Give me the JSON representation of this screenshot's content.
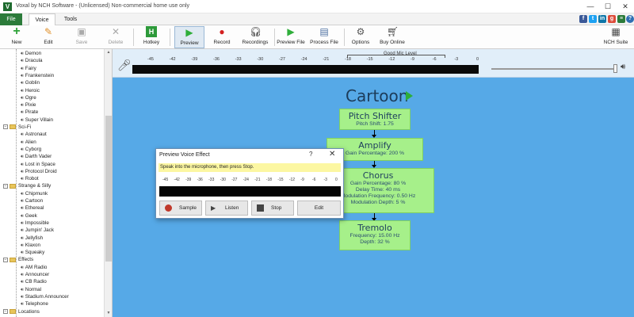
{
  "window": {
    "title": "Voxal by NCH Software - (Unlicensed) Non-commercial home use only",
    "app_icon": "V",
    "controls": {
      "minimize": "—",
      "maximize": "☐",
      "close": "✕"
    }
  },
  "menu": {
    "file": "File",
    "tabs": [
      "Voice",
      "Tools"
    ],
    "active_tab": "Voice"
  },
  "social_icons": [
    "facebook-icon",
    "twitter-icon",
    "linkedin-icon",
    "google-plus-icon",
    "nch-icon",
    "help-icon"
  ],
  "toolbar": {
    "new": "New",
    "edit": "Edit",
    "save": "Save",
    "delete": "Delete",
    "hotkey": "Hotkey",
    "preview": "Preview",
    "record": "Record",
    "recordings": "Recordings",
    "preview_file": "Preview File",
    "process_file": "Process File",
    "options": "Options",
    "buy_online": "Buy Online",
    "nch_suite": "NCH Suite"
  },
  "sidebar": {
    "rows": [
      {
        "type": "voice",
        "label": "Demon"
      },
      {
        "type": "voice",
        "label": "Dracula"
      },
      {
        "type": "voice",
        "label": "Fairy"
      },
      {
        "type": "voice",
        "label": "Frankenstein"
      },
      {
        "type": "voice",
        "label": "Goblin"
      },
      {
        "type": "voice",
        "label": "Heroic"
      },
      {
        "type": "voice",
        "label": "Ogre"
      },
      {
        "type": "voice",
        "label": "Pixie"
      },
      {
        "type": "voice",
        "label": "Pirate"
      },
      {
        "type": "voice",
        "label": "Super Villain"
      },
      {
        "type": "folder",
        "label": "Sci-Fi"
      },
      {
        "type": "voice",
        "label": "Astronaut"
      },
      {
        "type": "voice",
        "label": "Alien"
      },
      {
        "type": "voice",
        "label": "Cyborg"
      },
      {
        "type": "voice",
        "label": "Darth Vader"
      },
      {
        "type": "voice",
        "label": "Lost in Space"
      },
      {
        "type": "voice",
        "label": "Protocol Droid"
      },
      {
        "type": "voice",
        "label": "Robot"
      },
      {
        "type": "folder",
        "label": "Strange & Silly"
      },
      {
        "type": "voice",
        "label": "Chipmunk"
      },
      {
        "type": "voice",
        "label": "Cartoon"
      },
      {
        "type": "voice",
        "label": "Ethereal"
      },
      {
        "type": "voice",
        "label": "Geek"
      },
      {
        "type": "voice",
        "label": "Impossible"
      },
      {
        "type": "voice",
        "label": "Jumpin' Jack"
      },
      {
        "type": "voice",
        "label": "Jellyfish"
      },
      {
        "type": "voice",
        "label": "Klaxon"
      },
      {
        "type": "voice",
        "label": "Squeaky"
      },
      {
        "type": "folder",
        "label": "Effects"
      },
      {
        "type": "voice",
        "label": "AM Radio"
      },
      {
        "type": "voice",
        "label": "Announcer"
      },
      {
        "type": "voice",
        "label": "CB Radio"
      },
      {
        "type": "voice",
        "label": "Normal"
      },
      {
        "type": "voice",
        "label": "Stadium Announcer"
      },
      {
        "type": "voice",
        "label": "Telephone"
      },
      {
        "type": "folder",
        "label": "Locations"
      }
    ]
  },
  "level_meter": {
    "good_level_label": "Good Mic Level",
    "scale": [
      "-45",
      "-42",
      "-39",
      "-36",
      "-33",
      "-30",
      "-27",
      "-24",
      "-21",
      "-18",
      "-15",
      "-12",
      "-9",
      "-6",
      "-3",
      "0"
    ]
  },
  "voice": {
    "name": "Cartoon",
    "effects": [
      {
        "name": "Pitch Shifter",
        "params": [
          "Pitch Shift: 1.75"
        ]
      },
      {
        "name": "Amplify",
        "params": [
          "Gain Percentage: 200 %"
        ]
      },
      {
        "name": "Chorus",
        "params": [
          "Gain Percentage: 80 %",
          "Delay Time: 40 ms",
          "Modulation Frequency: 0.50 Hz",
          "Modulation Depth: 5 %"
        ]
      },
      {
        "name": "Tremolo",
        "params": [
          "Frequency: 15.00 Hz",
          "Depth: 32 %"
        ]
      }
    ]
  },
  "dialog": {
    "title": "Preview Voice Effect",
    "help": "?",
    "close": "✕",
    "message": "Speak into the microphone, then press Stop.",
    "scale": [
      "-45",
      "-42",
      "-39",
      "-36",
      "-33",
      "-30",
      "-27",
      "-24",
      "-21",
      "-18",
      "-15",
      "-12",
      "-9",
      "-6",
      "-3",
      "0"
    ],
    "buttons": {
      "sample": "Sample",
      "listen": "Listen",
      "stop": "Stop",
      "edit": "Edit"
    }
  },
  "colors": {
    "main_bg": "#56a9e7",
    "effect_box": "#a6f08a",
    "file_menu": "#2b7b3a",
    "message_bg": "#fcf7a2"
  }
}
